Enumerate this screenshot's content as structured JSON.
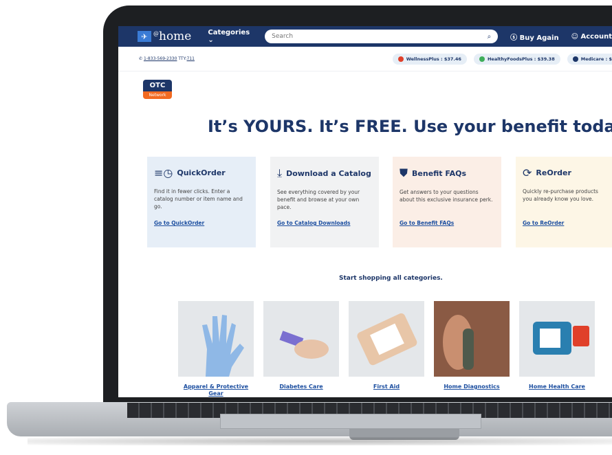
{
  "header": {
    "logo_prefix": "@",
    "logo_text": "home",
    "categories_label": "Categories ⌄",
    "search_placeholder": "Search",
    "buy_again_label": "Buy Again",
    "account_label": "Account"
  },
  "subbar": {
    "phone": "1-833-569-2330",
    "tty_label": "TTY:",
    "tty_number": "711",
    "benefits": [
      {
        "label": "WellnessPlus : $37.46",
        "color": "#e0402a"
      },
      {
        "label": "HealthyFoodsPlus : $39.38",
        "color": "#3fae5a"
      },
      {
        "label": "Medicare : $",
        "color": "#1d3668"
      }
    ]
  },
  "otc_badge": {
    "top": "OTC",
    "bottom": "Network"
  },
  "hero": {
    "title": "It’s YOURS. It’s FREE. Use your benefit today."
  },
  "cards": [
    {
      "title": "QuickOrder",
      "icon": "clock-icon",
      "desc": "Find it in fewer clicks. Enter a catalog number or item name and go.",
      "link": "Go to QuickOrder",
      "bg": "#e6eef7"
    },
    {
      "title": "Download a Catalog",
      "icon": "download-icon",
      "desc": "See everything covered by your benefit and browse at your own pace.",
      "link": "Go to Catalog Downloads",
      "bg": "#f1f2f3"
    },
    {
      "title": "Benefit FAQs",
      "icon": "shield-dollar-icon",
      "desc": "Get answers to your questions about this exclusive insurance perk.",
      "link": "Go to Benefit FAQs",
      "bg": "#fbeee6"
    },
    {
      "title": "ReOrder",
      "icon": "refresh-dollar-icon",
      "desc": "Quickly re-purchase products you already know you love.",
      "link": "Go to ReOrder",
      "bg": "#fdf6e6"
    }
  ],
  "section_title": "Start shopping all categories.",
  "categories": [
    {
      "label": "Apparel & Protective Gear"
    },
    {
      "label": "Diabetes Care"
    },
    {
      "label": "First Aid"
    },
    {
      "label": "Home Diagnostics"
    },
    {
      "label": "Home Health Care"
    }
  ]
}
